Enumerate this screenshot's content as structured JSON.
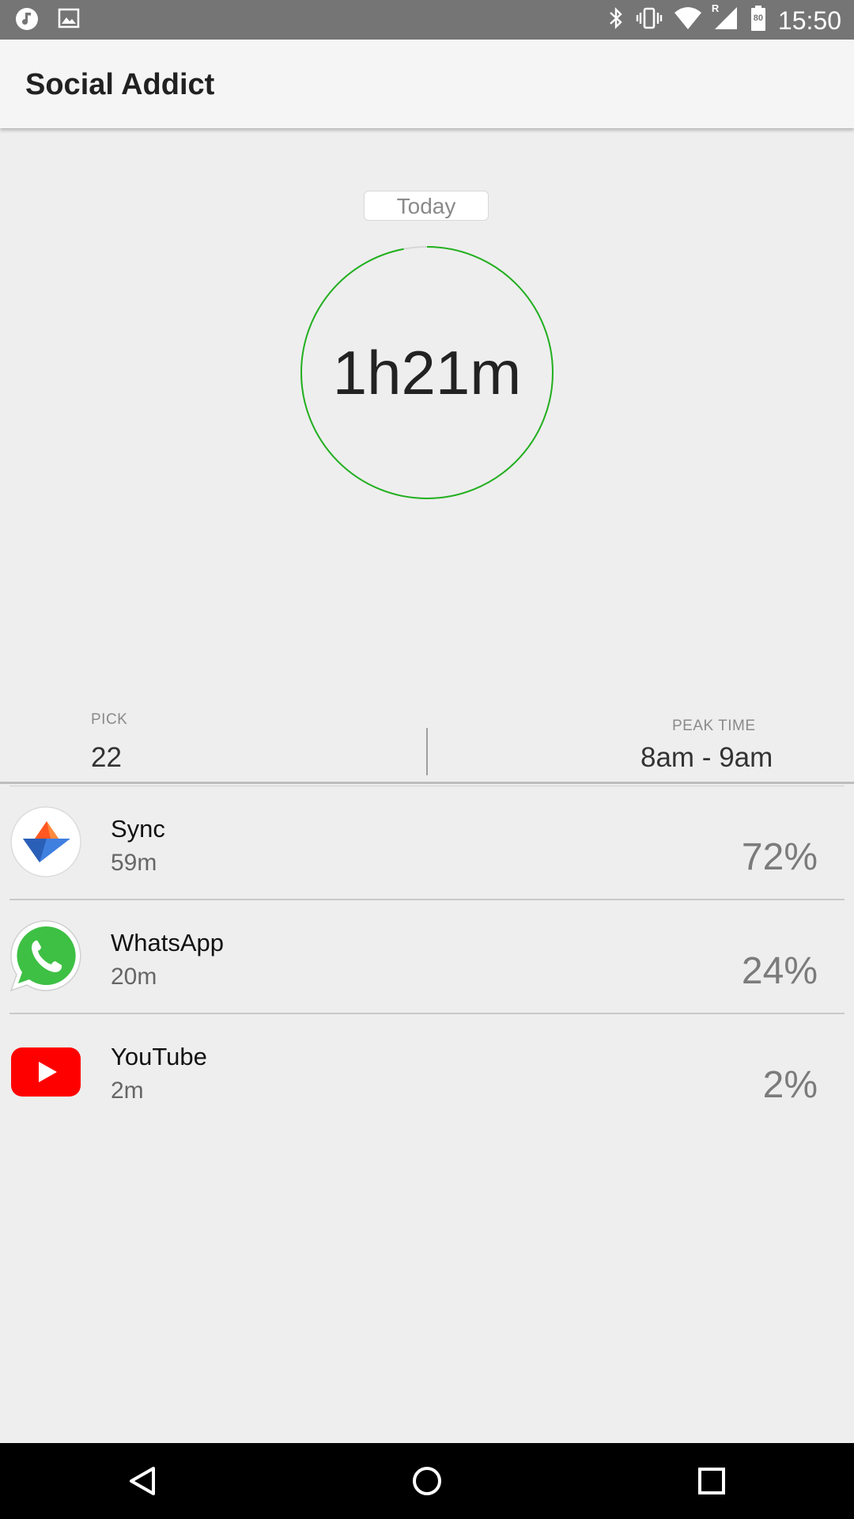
{
  "status_bar": {
    "time": "15:50",
    "battery_level": "80",
    "network_badge": "R",
    "icons": [
      "music-notification-icon",
      "image-notification-icon",
      "bluetooth-icon",
      "vibrate-icon",
      "wifi-icon",
      "cellular-signal-icon",
      "battery-icon"
    ]
  },
  "app_bar": {
    "title": "Social Addict"
  },
  "summary": {
    "range_label": "Today",
    "total_time": "1h21m",
    "ring_color": "#22b01f",
    "ring_track_color": "#d6d6d6",
    "ring_progress": 0.97
  },
  "stats": {
    "pick": {
      "label": "PICK",
      "value": "22"
    },
    "peak": {
      "label": "PEAK TIME",
      "value": "8am - 9am"
    }
  },
  "apps": [
    {
      "name": "Sync",
      "time": "59m",
      "percent": "72%",
      "icon": "sync-app-icon"
    },
    {
      "name": "WhatsApp",
      "time": "20m",
      "percent": "24%",
      "icon": "whatsapp-icon"
    },
    {
      "name": "YouTube",
      "time": "2m",
      "percent": "2%",
      "icon": "youtube-icon"
    }
  ],
  "nav_bar": {
    "buttons": [
      "back-icon",
      "home-icon",
      "recents-icon"
    ]
  }
}
